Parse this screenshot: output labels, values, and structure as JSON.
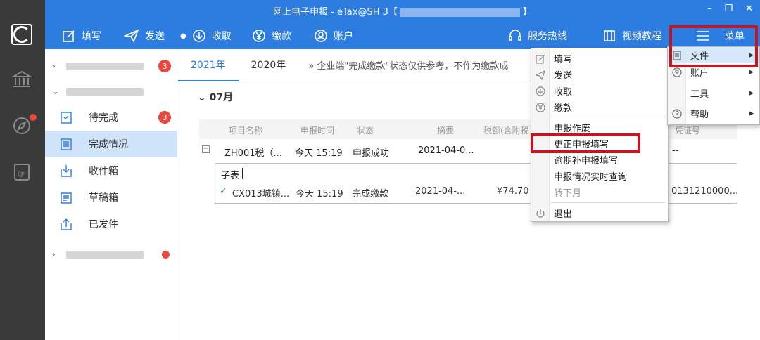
{
  "window": {
    "title_prefix": "网上电子申报 - eTax@SH 3【",
    "title_suffix": "】",
    "minimize": "–",
    "restore": "❐",
    "close": "✕"
  },
  "toolbar": {
    "fill": "填写",
    "send": "发送",
    "receive": "收取",
    "pay": "缴款",
    "account": "账户",
    "hotline": "服务热线",
    "video": "视频教程",
    "menu": "菜单"
  },
  "sidebar": {
    "group1_badge": "3",
    "items": [
      {
        "label": "待完成",
        "badge": "3"
      },
      {
        "label": "完成情况"
      },
      {
        "label": "收件箱"
      },
      {
        "label": "草稿箱"
      },
      {
        "label": "已发件"
      }
    ]
  },
  "main": {
    "tabs": [
      "2021年",
      "2020年"
    ],
    "notice": "» 企业端\"完成缴款\"状态仅供参考，不作为缴款成",
    "month": "07月",
    "columns": [
      "项目名称",
      "申报时间",
      "状态",
      "摘要",
      "税额(含附税",
      "凭证号"
    ],
    "row": {
      "expander": "−",
      "name": "ZH001税（...",
      "time": "今天 15:19",
      "status": "申报成功",
      "summary": "2021-04-0...",
      "voucher": "--"
    },
    "subtable": {
      "label": "子表",
      "check": "✓",
      "name": "CX013城镇...",
      "time": "今天 15:19",
      "status": "完成缴款",
      "summary": "2021-04-...",
      "amount": "¥74.70",
      "voucher": "0131210000..."
    }
  },
  "menu_main": {
    "items": [
      "填写",
      "发送",
      "收取",
      "缴款",
      "申报作废",
      "更正申报填写",
      "逾期补申报填写",
      "申报情况实时查询",
      "转下月",
      "退出"
    ]
  },
  "menu_right": {
    "items": [
      "文件",
      "账户",
      "工具",
      "帮助"
    ]
  },
  "colors": {
    "accent": "#2d7de0",
    "highlight": "#c8141e",
    "badge": "#e8483e"
  }
}
